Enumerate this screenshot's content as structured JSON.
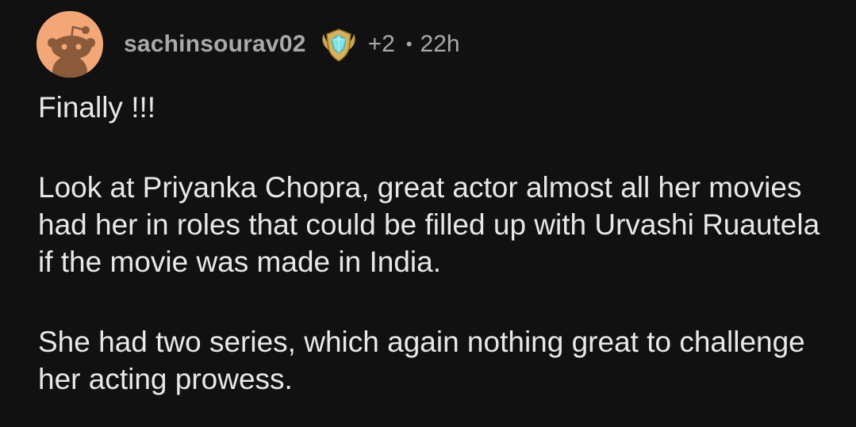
{
  "comment": {
    "author": {
      "username": "sachinsourav02",
      "avatar_icon": "snoo-avatar-icon",
      "avatar_bg": "#f3a777"
    },
    "award": {
      "icon": "platinum-award-icon",
      "count": "+2"
    },
    "separator": "•",
    "time": "22h",
    "paragraphs": [
      "Finally !!!",
      "Look at Priyanka Chopra, great actor almost all her movies had her in roles that could be filled up with Urvashi Ruautela if the movie was made in India.",
      "She had two series, which again nothing great to challenge her acting prowess."
    ]
  },
  "theme": {
    "background": "#111111",
    "text": "#e8e8e8",
    "meta_text": "#a9a9a9"
  }
}
